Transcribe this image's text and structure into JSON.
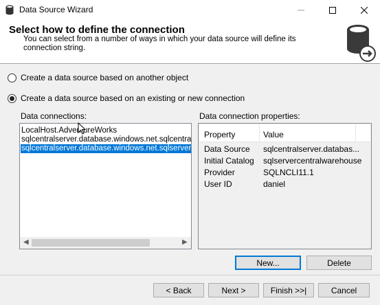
{
  "window": {
    "title": "Data Source Wizard",
    "minimize_glyph": "—",
    "maximize_glyph": "☐",
    "close_glyph": "✕"
  },
  "header": {
    "title": "Select how to define the connection",
    "description": "You can select from a number of ways in which your data source will define its connection string."
  },
  "options": {
    "another_object": "Create a data source based on another object",
    "existing_connection": "Create a data source based on an existing or new connection",
    "selected": "existing_connection"
  },
  "connections": {
    "label": "Data connections:",
    "items": [
      "LocalHost.AdventureWorks",
      "sqlcentralserver.database.windows.net.sqlcentralwarehouse",
      "sqlcentralserver.database.windows.net.sqlservercentralwarehouse"
    ],
    "selected_index": 2
  },
  "properties": {
    "label": "Data connection properties:",
    "col_property": "Property",
    "col_value": "Value",
    "rows": [
      {
        "key": "Data Source",
        "value": "sqlcentralserver.databas..."
      },
      {
        "key": "Initial Catalog",
        "value": "sqlservercentralwarehouse"
      },
      {
        "key": "Provider",
        "value": "SQLNCLI11.1"
      },
      {
        "key": "User ID",
        "value": "daniel"
      }
    ]
  },
  "buttons": {
    "new": "New...",
    "delete": "Delete",
    "back": "< Back",
    "next": "Next >",
    "finish": "Finish >>|",
    "cancel": "Cancel"
  },
  "icons": {
    "app": "database-icon",
    "header": "database-arrow-icon"
  },
  "colors": {
    "selection": "#0078d7",
    "background": "#f0f0f0"
  }
}
